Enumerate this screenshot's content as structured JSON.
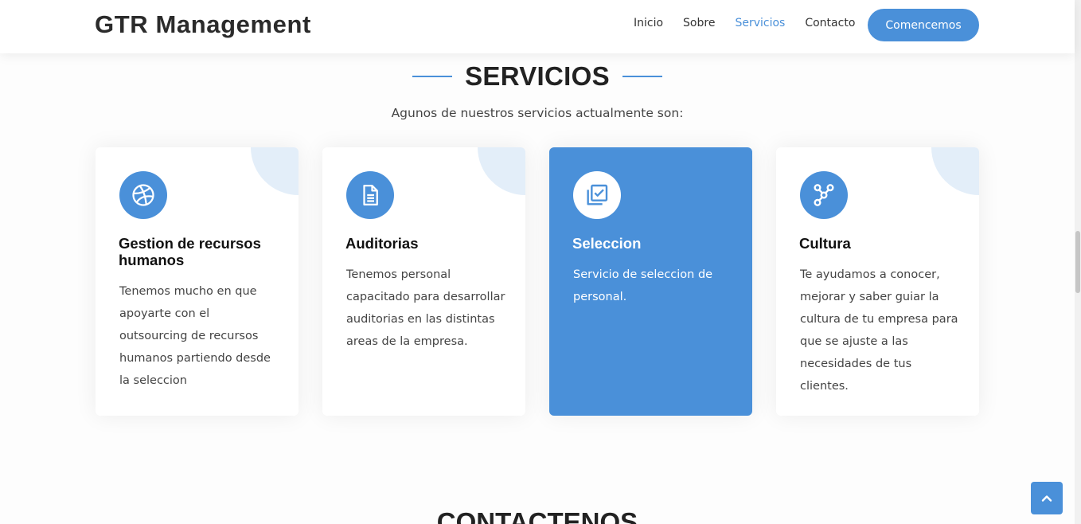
{
  "header": {
    "logo": "GTR Management",
    "nav": [
      "Inicio",
      "Sobre",
      "Servicios",
      "Contacto"
    ],
    "active_nav": "Servicios",
    "cta_label": "Comencemos"
  },
  "services": {
    "title": "SERVICIOS",
    "subtitle": "Agunos de nuestros servicios actualmente son:",
    "cards": [
      {
        "icon": "dribbble-icon",
        "title": "Gestion de recursos humanos",
        "description": "Tenemos mucho en que apoyarte con el outsourcing de recursos humanos partiendo desde la seleccion",
        "active": false
      },
      {
        "icon": "document-icon",
        "title": "Auditorias",
        "description": "Tenemos personal capacitado para desarrollar auditorias en las distintas areas de la empresa.",
        "active": false
      },
      {
        "icon": "check-stack-icon",
        "title": "Seleccion",
        "description": "Servicio de seleccion de personal.",
        "active": true
      },
      {
        "icon": "nodes-icon",
        "title": "Cultura",
        "description": "Te ayudamos a conocer, mejorar y saber guiar la cultura de tu empresa para que se ajuste a las necesidades de tus clientes.",
        "active": false
      }
    ]
  },
  "contact": {
    "title": "CONTACTENOS"
  },
  "colors": {
    "accent": "#4a90d9",
    "corner": "#e3eef9"
  },
  "back_to_top_icon": "chevron-up-icon"
}
